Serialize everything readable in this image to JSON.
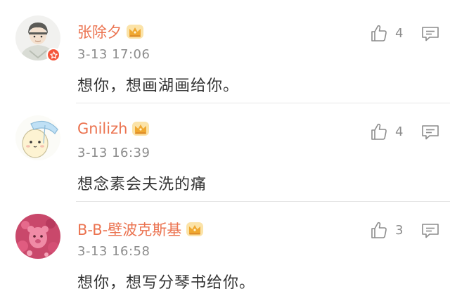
{
  "comments": [
    {
      "username": "张除夕",
      "time": "3-13 17:06",
      "text": "想你，想画湖画给你。",
      "likes": "4",
      "verified": true
    },
    {
      "username": "Gnilizh",
      "time": "3-13 16:39",
      "text": "想念素会夫洗的痛",
      "likes": "4",
      "verified": false
    },
    {
      "username": "B-B-壁波克斯基",
      "time": "3-13 16:58",
      "text": "想你，想写分琴书给你。",
      "likes": "3",
      "verified": false
    }
  ],
  "colors": {
    "username": "#eb7350",
    "text": "#333333",
    "meta": "#8c8c8c",
    "badge": "#f5553a",
    "crown": "#f0a830"
  },
  "icons": {
    "like": "thumbs-up-icon",
    "reply": "comment-bubble-icon",
    "member": "crown-icon",
    "verified": "verified-star-icon"
  }
}
